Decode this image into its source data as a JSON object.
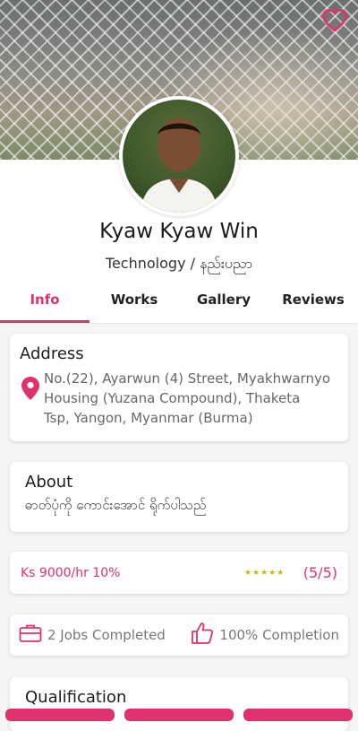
{
  "profile": {
    "name": "Kyaw Kyaw Win",
    "category": "Technology / နည်းပညာ"
  },
  "tabs": [
    "Info",
    "Works",
    "Gallery",
    "Reviews"
  ],
  "active_tab": "Info",
  "address": {
    "title": "Address",
    "lines": [
      "No.(22), Ayarwun (4) Street, Myakhwarnyo",
      "Housing (Yuzana Compound), Thaketa",
      "Tsp, Yangon, Myanmar (Burma)"
    ]
  },
  "about": {
    "title": "About",
    "text": "ဓာတ်ပုံကို ကောင်းအောင် ရိုက်ပါသည်"
  },
  "pricing": {
    "rate": "Ks 9000/hr 10%",
    "stars": "★★★★★",
    "score": "(5/5)"
  },
  "stats": {
    "jobs": "2 Jobs Completed",
    "completion": "100% Completion"
  },
  "qualification": {
    "title": "Qualification"
  },
  "colors": {
    "accent": "#e0306e",
    "star": "#c8b800"
  },
  "icons": [
    "heart-icon",
    "location-pin-icon",
    "briefcase-icon",
    "thumbs-up-icon"
  ]
}
